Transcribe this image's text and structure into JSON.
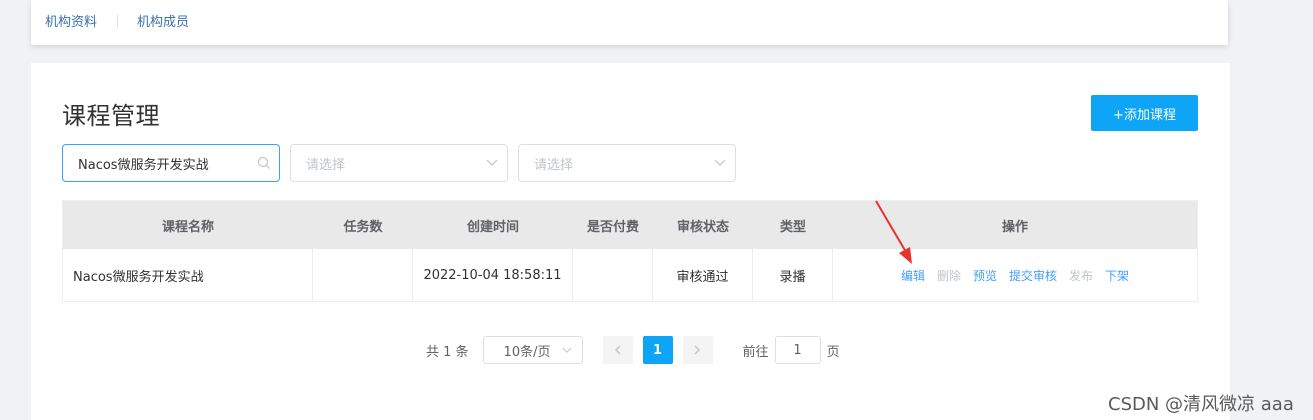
{
  "top_tabs": [
    "机构资料",
    "机构成员"
  ],
  "page": {
    "title": "课程管理",
    "add_button": "+添加课程"
  },
  "filters": {
    "search_value": "Nacos微服务开发实战",
    "select1_placeholder": "请选择",
    "select2_placeholder": "请选择"
  },
  "table": {
    "columns": [
      "课程名称",
      "任务数",
      "创建时间",
      "是否付费",
      "审核状态",
      "类型",
      "操作"
    ],
    "rows": [
      {
        "name": "Nacos微服务开发实战",
        "tasks": "",
        "created": "2022-10-04 18:58:11",
        "paid": "",
        "status": "审核通过",
        "type": "录播",
        "actions": [
          {
            "label": "编辑",
            "enabled": true
          },
          {
            "label": "删除",
            "enabled": false
          },
          {
            "label": "预览",
            "enabled": true
          },
          {
            "label": "提交审核",
            "enabled": true
          },
          {
            "label": "发布",
            "enabled": false
          },
          {
            "label": "下架",
            "enabled": true
          }
        ]
      }
    ]
  },
  "pagination": {
    "total_text": "共 1 条",
    "page_size": "10条/页",
    "current_page": "1",
    "goto_label": "前往",
    "goto_value": "1",
    "page_suffix": "页"
  },
  "watermark": "CSDN @清风微凉 aaa",
  "colors": {
    "primary": "#409eff",
    "button": "#0ea5f6",
    "annotation_arrow": "#e8322e"
  }
}
